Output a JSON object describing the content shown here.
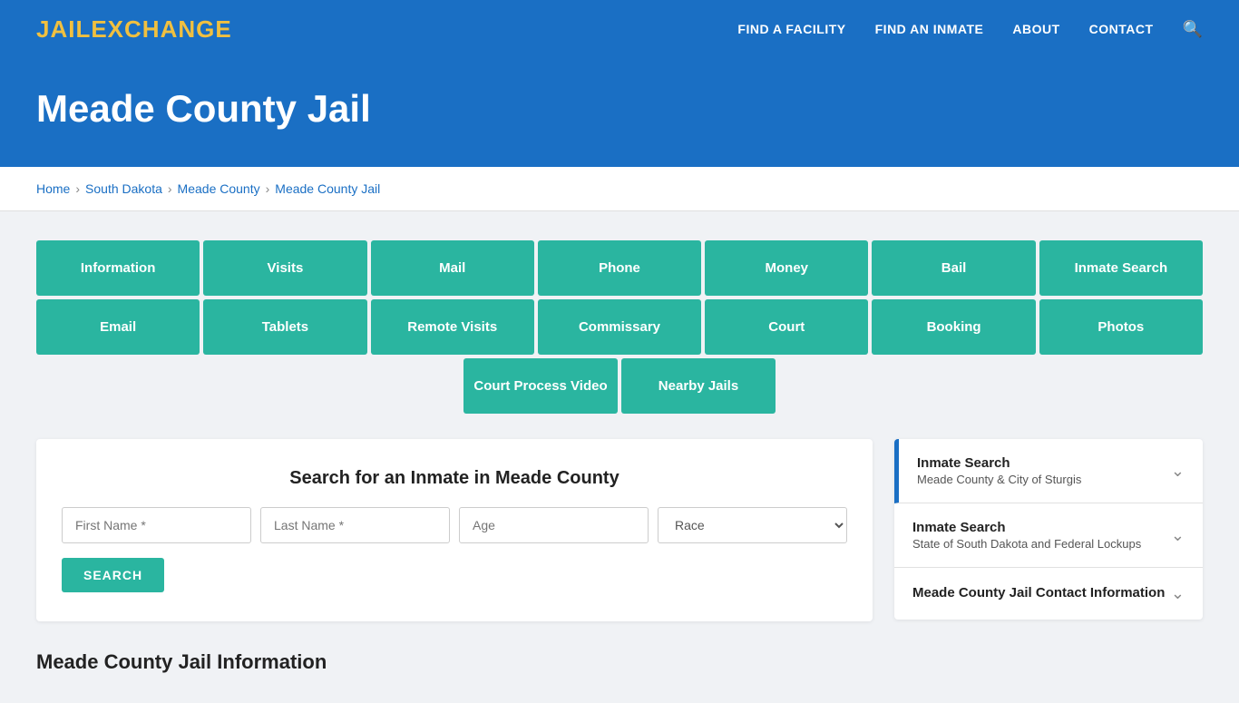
{
  "header": {
    "logo_part1": "JAIL",
    "logo_part2": "EXCHANGE",
    "nav": [
      {
        "label": "FIND A FACILITY",
        "href": "#"
      },
      {
        "label": "FIND AN INMATE",
        "href": "#"
      },
      {
        "label": "ABOUT",
        "href": "#"
      },
      {
        "label": "CONTACT",
        "href": "#"
      }
    ]
  },
  "hero": {
    "title": "Meade County Jail"
  },
  "breadcrumb": {
    "items": [
      {
        "label": "Home",
        "href": "#"
      },
      {
        "label": "South Dakota",
        "href": "#"
      },
      {
        "label": "Meade County",
        "href": "#"
      },
      {
        "label": "Meade County Jail",
        "href": "#"
      }
    ]
  },
  "buttons_row1": [
    {
      "label": "Information"
    },
    {
      "label": "Visits"
    },
    {
      "label": "Mail"
    },
    {
      "label": "Phone"
    },
    {
      "label": "Money"
    },
    {
      "label": "Bail"
    },
    {
      "label": "Inmate Search"
    }
  ],
  "buttons_row2": [
    {
      "label": "Email"
    },
    {
      "label": "Tablets"
    },
    {
      "label": "Remote Visits"
    },
    {
      "label": "Commissary"
    },
    {
      "label": "Court"
    },
    {
      "label": "Booking"
    },
    {
      "label": "Photos"
    }
  ],
  "buttons_row3": [
    {
      "label": "Court Process Video"
    },
    {
      "label": "Nearby Jails"
    }
  ],
  "inmate_search": {
    "title": "Search for an Inmate in Meade County",
    "first_name_placeholder": "First Name *",
    "last_name_placeholder": "Last Name *",
    "age_placeholder": "Age",
    "race_placeholder": "Race",
    "search_button": "SEARCH"
  },
  "section": {
    "heading": "Meade County Jail Information"
  },
  "sidebar": {
    "items": [
      {
        "title": "Inmate Search",
        "subtitle": "Meade County & City of Sturgis",
        "active": true
      },
      {
        "title": "Inmate Search",
        "subtitle": "State of South Dakota and Federal Lockups",
        "active": false
      },
      {
        "title": "Meade County Jail Contact Information",
        "subtitle": "",
        "active": false
      }
    ]
  }
}
